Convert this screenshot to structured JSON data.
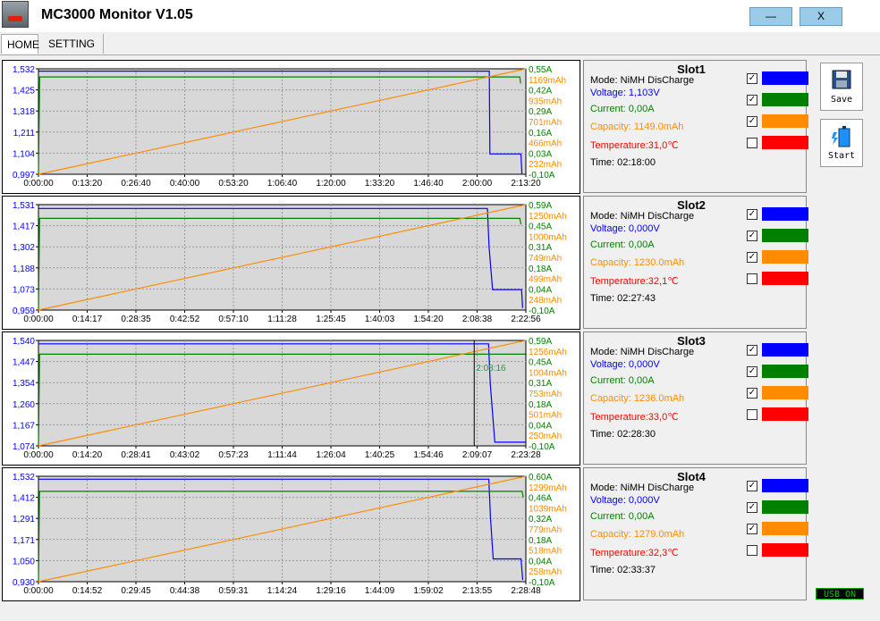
{
  "window": {
    "title": "MC3000 Monitor V1.05",
    "minimize_label": "—",
    "close_label": "X"
  },
  "tabs": [
    {
      "label": "HOME",
      "active": true
    },
    {
      "label": "SETTING",
      "active": false
    }
  ],
  "side_buttons": {
    "save_label": "Save",
    "start_label": "Start"
  },
  "status": {
    "usb": "USB ON"
  },
  "colors": {
    "voltage": "#0000ff",
    "current": "#008000",
    "capacity": "#ff8c00",
    "temperature": "#ff0000",
    "chart_bg": "#d8d8d8"
  },
  "slots": [
    {
      "title": "Slot1",
      "mode": "Mode: NiMH DisCharge",
      "voltage": "Voltage: 1,103V",
      "current": "Current: 0,00A",
      "capacity": "Capacity: 1149.0mAh",
      "temperature": "Temperature:31,0℃",
      "time": "Time: 02:18:00",
      "checks": [
        true,
        true,
        true,
        false
      ]
    },
    {
      "title": "Slot2",
      "mode": "Mode: NiMH DisCharge",
      "voltage": "Voltage: 0,000V",
      "current": "Current: 0,00A",
      "capacity": "Capacity: 1230.0mAh",
      "temperature": "Temperature:32,1℃",
      "time": "Time: 02:27:43",
      "checks": [
        true,
        true,
        true,
        false
      ]
    },
    {
      "title": "Slot3",
      "mode": "Mode: NiMH DisCharge",
      "voltage": "Voltage: 0,000V",
      "current": "Current: 0,00A",
      "capacity": "Capacity: 1236.0mAh",
      "temperature": "Temperature:33,0℃",
      "time": "Time: 02:28:30",
      "checks": [
        true,
        true,
        true,
        false
      ]
    },
    {
      "title": "Slot4",
      "mode": "Mode: NiMH DisCharge",
      "voltage": "Voltage: 0,000V",
      "current": "Current: 0,00A",
      "capacity": "Capacity: 1279.0mAh",
      "temperature": "Temperature:32,3℃",
      "time": "Time: 02:33:37",
      "checks": [
        true,
        true,
        true,
        false
      ]
    }
  ],
  "chart_data": [
    {
      "type": "line",
      "title": "",
      "x_ticks": [
        "0:00:00",
        "0:13:20",
        "0:26:40",
        "0:40:00",
        "0:53:20",
        "1:06:40",
        "1:20:00",
        "1:33:20",
        "1:46:40",
        "2:00:00",
        "2:13:20"
      ],
      "y_left_ticks": [
        "1,532",
        "1,425",
        "1,318",
        "1,211",
        "1,104",
        "0,997"
      ],
      "y_right_current_ticks": [
        "0,55A",
        "0,42A",
        "0,29A",
        "0,16A",
        "0,03A",
        "-0,10A"
      ],
      "y_right_capacity_ticks": [
        "1169mAh",
        "935mAh",
        "701mAh",
        "466mAh",
        "232mAh"
      ],
      "x_range_sec": [
        0,
        8000
      ],
      "voltage_range": [
        0.997,
        1.532
      ],
      "current_range": [
        -0.1,
        0.55
      ],
      "capacity_range": [
        0,
        1169
      ],
      "series": [
        {
          "name": "Voltage",
          "color": "#0000ff",
          "axis": "left",
          "x_sec": [
            0,
            300,
            7400,
            7410,
            7700,
            7920,
            7935
          ],
          "values": [
            1.52,
            1.52,
            1.52,
            1.1,
            1.1,
            1.1,
            1.0
          ]
        },
        {
          "name": "Current",
          "color": "#008000",
          "axis": "right_current",
          "x_sec": [
            0,
            20,
            7900,
            7915
          ],
          "values": [
            -0.1,
            0.5,
            0.5,
            0.46
          ]
        },
        {
          "name": "Capacity",
          "color": "#ff8c00",
          "axis": "right_capacity",
          "x_sec": [
            0,
            8000
          ],
          "values": [
            0,
            1169
          ]
        }
      ]
    },
    {
      "type": "line",
      "title": "",
      "x_ticks": [
        "0:00:00",
        "0:14:17",
        "0:28:35",
        "0:42:52",
        "0:57:10",
        "1:11:28",
        "1:25:45",
        "1:40:03",
        "1:54:20",
        "2:08:38",
        "2:22:56"
      ],
      "y_left_ticks": [
        "1,531",
        "1,417",
        "1,302",
        "1,188",
        "1,073",
        "0,959"
      ],
      "y_right_current_ticks": [
        "0,59A",
        "0,45A",
        "0,31A",
        "0,18A",
        "0,04A",
        "-0,10A"
      ],
      "y_right_capacity_ticks": [
        "1250mAh",
        "1000mAh",
        "749mAh",
        "499mAh",
        "248mAh"
      ],
      "x_range_sec": [
        0,
        8576
      ],
      "voltage_range": [
        0.959,
        1.531
      ],
      "current_range": [
        -0.1,
        0.59
      ],
      "capacity_range": [
        0,
        1250
      ],
      "series": [
        {
          "name": "Voltage",
          "color": "#0000ff",
          "axis": "left",
          "x_sec": [
            0,
            1600,
            4800,
            7900,
            7930,
            7990,
            8500,
            8520
          ],
          "values": [
            1.51,
            1.51,
            1.51,
            1.51,
            1.3,
            1.07,
            1.07,
            0.97
          ]
        },
        {
          "name": "Current",
          "color": "#008000",
          "axis": "right_current",
          "x_sec": [
            0,
            20,
            8470,
            8490
          ],
          "values": [
            -0.1,
            0.5,
            0.5,
            0.46
          ]
        },
        {
          "name": "Capacity",
          "color": "#ff8c00",
          "axis": "right_capacity",
          "x_sec": [
            0,
            8576
          ],
          "values": [
            0,
            1250
          ]
        }
      ]
    },
    {
      "type": "line",
      "title": "",
      "cursor_label": "2:08:16",
      "cursor_sec": 7696,
      "x_ticks": [
        "0:00:00",
        "0:14:20",
        "0:28:41",
        "0:43:02",
        "0:57:23",
        "1:11:44",
        "1:26:04",
        "1:40:25",
        "1:54:46",
        "2:09:07",
        "2:23:28"
      ],
      "y_left_ticks": [
        "1,540",
        "1,447",
        "1,354",
        "1,260",
        "1,167",
        "1,074"
      ],
      "y_right_current_ticks": [
        "0,59A",
        "0,45A",
        "0,31A",
        "0,18A",
        "0,04A",
        "-0,10A"
      ],
      "y_right_capacity_ticks": [
        "1256mAh",
        "1004mAh",
        "753mAh",
        "501mAh",
        "250mAh"
      ],
      "x_range_sec": [
        0,
        8608
      ],
      "voltage_range": [
        1.074,
        1.54
      ],
      "current_range": [
        -0.1,
        0.59
      ],
      "capacity_range": [
        0,
        1256
      ],
      "series": [
        {
          "name": "Voltage",
          "color": "#0000ff",
          "axis": "left",
          "x_sec": [
            0,
            7950,
            7980,
            8060,
            8560,
            8600
          ],
          "values": [
            1.525,
            1.525,
            1.35,
            1.09,
            1.09,
            1.09
          ]
        },
        {
          "name": "Current",
          "color": "#008000",
          "axis": "right_current",
          "x_sec": [
            0,
            20,
            8600
          ],
          "values": [
            -0.1,
            0.5,
            0.5
          ]
        },
        {
          "name": "Capacity",
          "color": "#ff8c00",
          "axis": "right_capacity",
          "x_sec": [
            0,
            8608
          ],
          "values": [
            0,
            1256
          ]
        }
      ]
    },
    {
      "type": "line",
      "title": "",
      "x_ticks": [
        "0:00:00",
        "0:14:52",
        "0:29:45",
        "0:44:38",
        "0:59:31",
        "1:14:24",
        "1:29:16",
        "1:44:09",
        "1:59:02",
        "2:13:55",
        "2:28:48"
      ],
      "y_left_ticks": [
        "1,532",
        "1,412",
        "1,291",
        "1,171",
        "1,050",
        "0,930"
      ],
      "y_right_current_ticks": [
        "0,60A",
        "0,46A",
        "0,32A",
        "0,18A",
        "0,04A",
        "-0,10A"
      ],
      "y_right_capacity_ticks": [
        "1299mAh",
        "1039mAh",
        "779mAh",
        "518mAh",
        "258mAh"
      ],
      "x_range_sec": [
        0,
        8928
      ],
      "voltage_range": [
        0.93,
        1.532
      ],
      "current_range": [
        -0.1,
        0.6
      ],
      "capacity_range": [
        0,
        1299
      ],
      "series": [
        {
          "name": "Voltage",
          "color": "#0000ff",
          "axis": "left",
          "x_sec": [
            0,
            8250,
            8280,
            8330,
            8840,
            8870
          ],
          "values": [
            1.515,
            1.515,
            1.3,
            1.06,
            1.06,
            0.94
          ]
        },
        {
          "name": "Current",
          "color": "#008000",
          "axis": "right_current",
          "x_sec": [
            0,
            20,
            8860,
            8880
          ],
          "values": [
            -0.1,
            0.5,
            0.5,
            0.46
          ]
        },
        {
          "name": "Capacity",
          "color": "#ff8c00",
          "axis": "right_capacity",
          "x_sec": [
            0,
            8928
          ],
          "values": [
            0,
            1299
          ]
        }
      ]
    }
  ]
}
